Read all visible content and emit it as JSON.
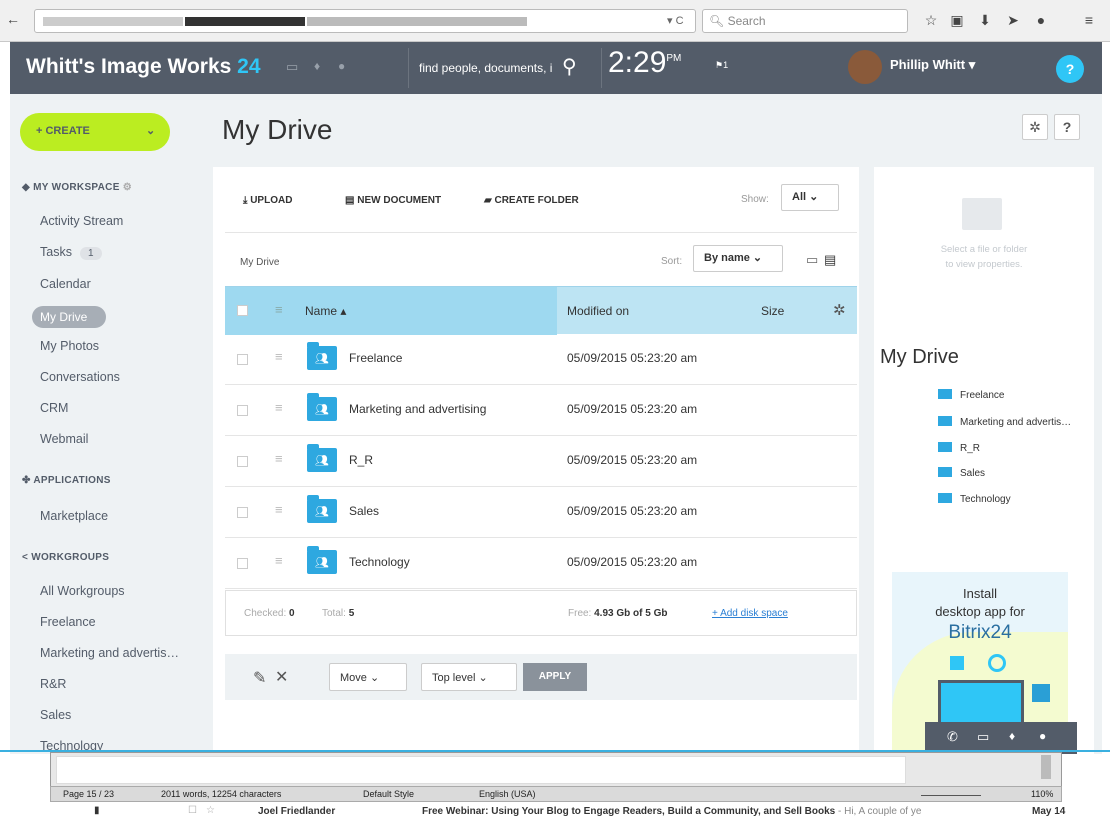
{
  "browser": {
    "search_placeholder": "Search",
    "reload": "▾ C"
  },
  "header": {
    "org": "Whitt's Image Works",
    "org_num": "24",
    "search_placeholder": "find people, documents, i",
    "clock": "2:29",
    "ampm": "PM",
    "flag_count": "1",
    "user": "Phillip Whitt",
    "help": "?"
  },
  "create_label": "+ CREATE",
  "page_title": "My Drive",
  "sidebar": {
    "workspace": "MY WORKSPACE",
    "items": [
      "Activity Stream",
      "Tasks",
      "Calendar",
      "My Drive",
      "My Photos",
      "Conversations",
      "CRM",
      "Webmail"
    ],
    "tasks_badge": "1",
    "applications": "APPLICATIONS",
    "marketplace": "Marketplace",
    "workgroups": "WORKGROUPS",
    "groups": [
      "All Workgroups",
      "Freelance",
      "Marketing and advertis…",
      "R&R",
      "Sales",
      "Technology"
    ]
  },
  "toolbar": {
    "upload": "UPLOAD",
    "new_doc": "NEW DOCUMENT",
    "create_folder": "CREATE FOLDER",
    "show_label": "Show:",
    "show_value": "All",
    "sort_label": "Sort:",
    "sort_value": "By name",
    "breadcrumb": "My Drive"
  },
  "table": {
    "headers": {
      "name": "Name ▴",
      "modified": "Modified on",
      "size": "Size"
    },
    "rows": [
      {
        "name": "Freelance",
        "date": "05/09/2015 05:23:20 am"
      },
      {
        "name": "Marketing and advertising",
        "date": "05/09/2015 05:23:20 am"
      },
      {
        "name": "R_R",
        "date": "05/09/2015 05:23:20 am"
      },
      {
        "name": "Sales",
        "date": "05/09/2015 05:23:20 am"
      },
      {
        "name": "Technology",
        "date": "05/09/2015 05:23:20 am"
      }
    ]
  },
  "footer": {
    "checked_label": "Checked:",
    "checked": "0",
    "total_label": "Total:",
    "total": "5",
    "free_label": "Free:",
    "free": "4.93 Gb of 5 Gb",
    "add_space": "+ Add disk space"
  },
  "actions": {
    "move": "Move",
    "level": "Top level",
    "apply": "APPLY"
  },
  "props": {
    "hint1": "Select a file or folder",
    "hint2": "to view properties.",
    "title": "My Drive",
    "folders": [
      "Freelance",
      "Marketing and advertis…",
      "R_R",
      "Sales",
      "Technology"
    ]
  },
  "banner": {
    "line1": "Install",
    "line2": "desktop app for",
    "brand": "Bitrix24"
  },
  "writer": {
    "page": "Page 15 / 23",
    "words": "2011 words, 12254 characters",
    "style": "Default Style",
    "lang": "English (USA)",
    "zoom": "110%"
  },
  "mail": {
    "from": "Joel Friedlander",
    "subject": "Free Webinar: Using Your Blog to Engage Readers, Build a Community, and Sell Books",
    "preview": " - Hi, A couple of ye",
    "date": "May 14"
  }
}
